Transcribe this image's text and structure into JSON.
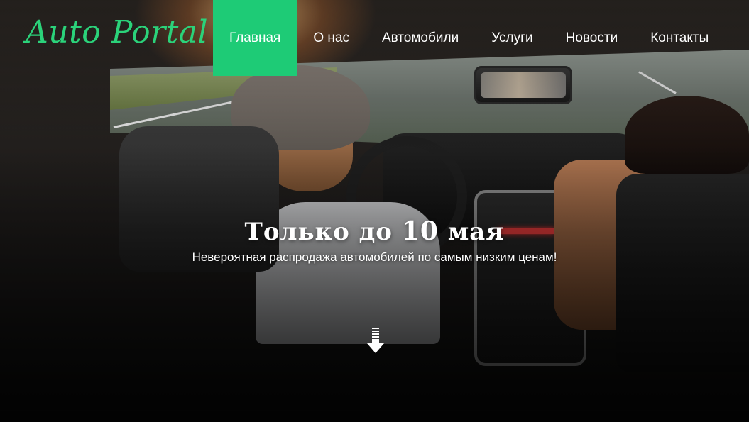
{
  "brand": {
    "logo_text": "Auto Portal",
    "accent_color": "#1ecb76"
  },
  "nav": {
    "items": [
      {
        "label": "Главная",
        "active": true
      },
      {
        "label": "О нас",
        "active": false
      },
      {
        "label": "Автомобили",
        "active": false
      },
      {
        "label": "Услуги",
        "active": false
      },
      {
        "label": "Новости",
        "active": false
      },
      {
        "label": "Контакты",
        "active": false
      }
    ]
  },
  "hero": {
    "headline_prefix": "Только до",
    "headline_number": "10",
    "headline_suffix": "мая",
    "subtitle": "Невероятная распродажа автомобилей по самым низким ценам!",
    "scroll_icon": "arrow-down-icon"
  }
}
